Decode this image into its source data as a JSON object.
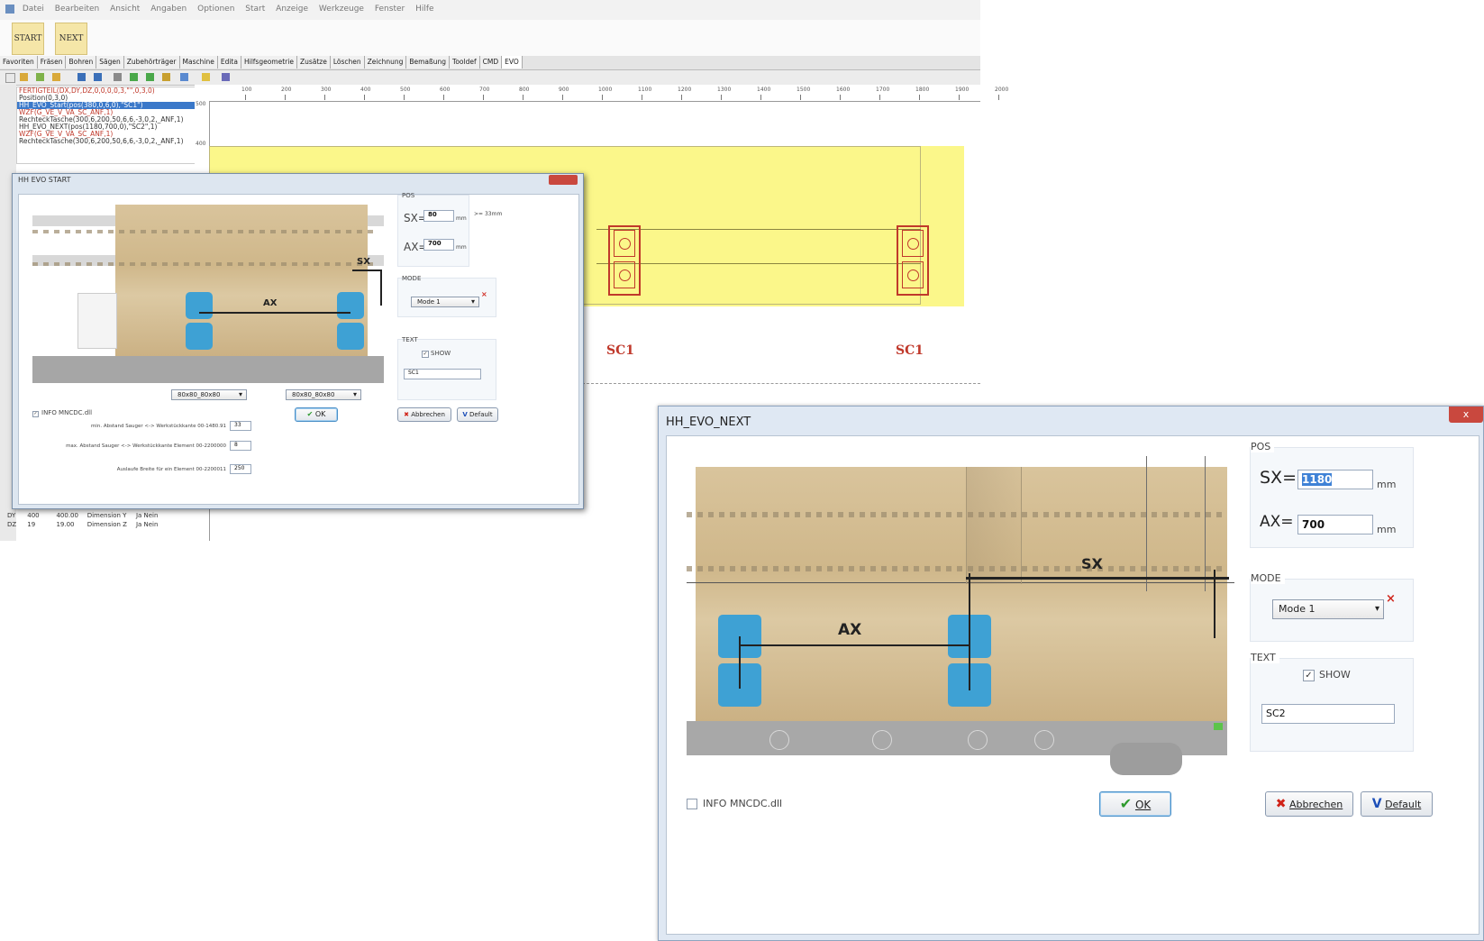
{
  "app": {
    "menu": [
      "Datei",
      "Bearbeiten",
      "Ansicht",
      "Angaben",
      "Optionen",
      "Start",
      "Anzeige",
      "Werkzeuge",
      "Fenster",
      "Hilfe"
    ],
    "big_buttons": [
      "START",
      "NEXT"
    ],
    "tabs": [
      "Favoriten",
      "Fräsen",
      "Bohren",
      "Sägen",
      "Zubehörträger",
      "Maschine",
      "Edita",
      "Hilfsgeometrie",
      "Zusätze",
      "Löschen",
      "Zeichnung",
      "Bemaßung",
      "Tooldef",
      "CMD",
      "EVO"
    ],
    "ruler_ticks": [
      "100",
      "200",
      "300",
      "400",
      "500",
      "600",
      "700",
      "800",
      "900",
      "1000",
      "1100",
      "1200",
      "1300",
      "1400",
      "1500",
      "1600",
      "1700",
      "1800",
      "1900",
      "2000"
    ],
    "ruler_vertical": [
      "500",
      "400"
    ],
    "tree_items": [
      {
        "text": "FERTIGTEIL(DX,DY,DZ,0,0,0,0,3,\"\",0,3,0)",
        "style": "red"
      },
      {
        "text": "Position(0,3,0)",
        "style": "normal"
      },
      {
        "text": "HH_EVO_Start(pos(380,0,6,0),\"SC1\")",
        "style": "selected"
      },
      {
        "text": "WZF(G_VE_V_VA_SC_ANF,1)",
        "style": "red"
      },
      {
        "text": "RechteckTasche(300,6,200,50,6,6,-3,0,2,_ANF,1)",
        "style": "normal"
      },
      {
        "text": "HH_EVO_NEXT(pos(1180,700,0),\"SC2\",1)",
        "style": "normal"
      },
      {
        "text": "WZF(G_VE_V_VA_SC_ANF,1)",
        "style": "red"
      },
      {
        "text": "RechteckTasche(300,6,200,50,6,6,-3,0,2,_ANF,1)",
        "style": "normal"
      }
    ],
    "canvas_labels": [
      "SC1",
      "SC1"
    ],
    "prop_rows": [
      [
        "DY",
        "400",
        "400.00",
        "Dimension Y",
        "Ja Nein"
      ],
      [
        "DZ",
        "19",
        "19.00",
        "Dimension Z",
        "Ja Nein"
      ]
    ]
  },
  "dialog_start": {
    "title": "HH EVO START",
    "pos_group": "POS",
    "sx_label": "SX=",
    "sx_value": "80",
    "sx_unit": "mm",
    "sx_hint": ">= 33mm",
    "ax_label": "AX=",
    "ax_value": "700",
    "ax_unit": "mm",
    "mode_group": "MODE",
    "mode_value": "Mode 1",
    "text_group": "TEXT",
    "show_label": "SHOW",
    "text_value": "SC1",
    "dim_ax": "AX",
    "dim_sx": "SX",
    "cup_select_1": "80x80_80x80",
    "cup_select_2": "80x80_80x80",
    "info_label": "INFO MNCDC.dll",
    "ok_label": "OK",
    "cancel_label": "Abbrechen",
    "default_label": "Default",
    "param_rows": [
      {
        "label": "min. Abstand Sauger <-> Werkstückkante 00-1480.91",
        "value": "33"
      },
      {
        "label": "max. Abstand Sauger <-> Werkstückkante Element 00-2200000",
        "value": "8"
      },
      {
        "label": "Auslaufe Breite für ein Element 00-2200011",
        "value": "250"
      }
    ]
  },
  "dialog_next": {
    "title": "HH_EVO_NEXT",
    "close_label": "x",
    "pos_group": "POS",
    "sx_label": "SX=",
    "sx_value": "1180",
    "sx_unit": "mm",
    "ax_label": "AX=",
    "ax_value": "700",
    "ax_unit": "mm",
    "mode_group": "MODE",
    "mode_value": "Mode 1",
    "text_group": "TEXT",
    "show_label": "SHOW",
    "show_checked": true,
    "text_value": "SC2",
    "dim_ax": "AX",
    "dim_sx": "SX",
    "info_label": "INFO MNCDC.dll",
    "info_checked": false,
    "ok_label": "OK",
    "cancel_label": "Abbrechen",
    "default_label": "Default"
  },
  "colors": {
    "suction_cup": "#3ea1d4",
    "canvas_yellow": "#fbf78a",
    "marker_red": "#c0392b",
    "dialog_frame": "#dfe8f3"
  }
}
